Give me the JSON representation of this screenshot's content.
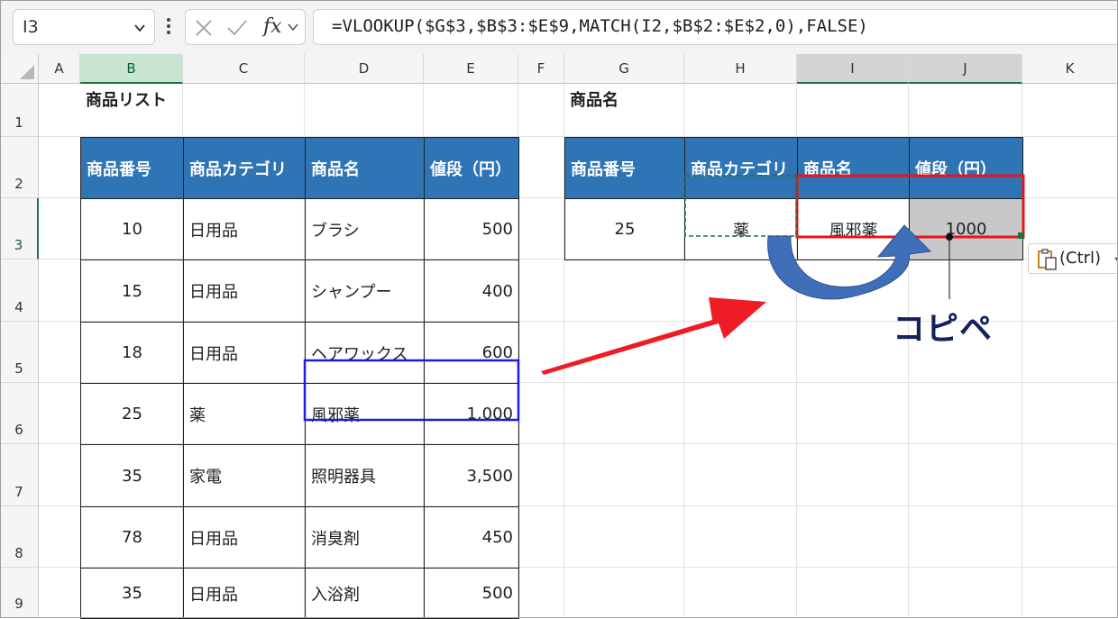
{
  "name_box": {
    "value": "I3"
  },
  "formula_bar": {
    "fx_label": "fx",
    "formula": "=VLOOKUP($G$3,$B$3:$E$9,MATCH(I2,$B$2:$E$2,0),FALSE)"
  },
  "columns": [
    "A",
    "B",
    "C",
    "D",
    "E",
    "F",
    "G",
    "H",
    "I",
    "J",
    "K"
  ],
  "rows": [
    "1",
    "2",
    "3",
    "4",
    "5",
    "6",
    "7",
    "8",
    "9"
  ],
  "product_list": {
    "title": "商品リスト",
    "headers": [
      "商品番号",
      "商品カテゴリ",
      "商品名",
      "値段（円）"
    ],
    "rows": [
      {
        "no": "10",
        "category": "日用品",
        "name": "ブラシ",
        "price": "500"
      },
      {
        "no": "15",
        "category": "日用品",
        "name": "シャンプー",
        "price": "400"
      },
      {
        "no": "18",
        "category": "日用品",
        "name": "ヘアワックス",
        "price": "600"
      },
      {
        "no": "25",
        "category": "薬",
        "name": "風邪薬",
        "price": "1,000"
      },
      {
        "no": "35",
        "category": "家電",
        "name": "照明器具",
        "price": "3,500"
      },
      {
        "no": "78",
        "category": "日用品",
        "name": "消臭剤",
        "price": "450"
      },
      {
        "no": "35",
        "category": "日用品",
        "name": "入浴剤",
        "price": "500"
      }
    ]
  },
  "lookup": {
    "title": "商品名",
    "headers": [
      "商品番号",
      "商品カテゴリ",
      "商品名",
      "値段（円）"
    ],
    "row": {
      "no": "25",
      "category": "薬",
      "name": "風邪薬",
      "price": "1000"
    }
  },
  "annotation": {
    "label": "コピペ"
  },
  "paste_options": {
    "label": "(Ctrl)"
  },
  "colors": {
    "header_fill": "#2f74b5",
    "selection_green": "#1e7145",
    "highlight_red": "#e8141c",
    "highlight_blue": "#1c1ce0",
    "arrow_blue": "#3f6fb8",
    "selected_fill": "#c8c8c8"
  }
}
